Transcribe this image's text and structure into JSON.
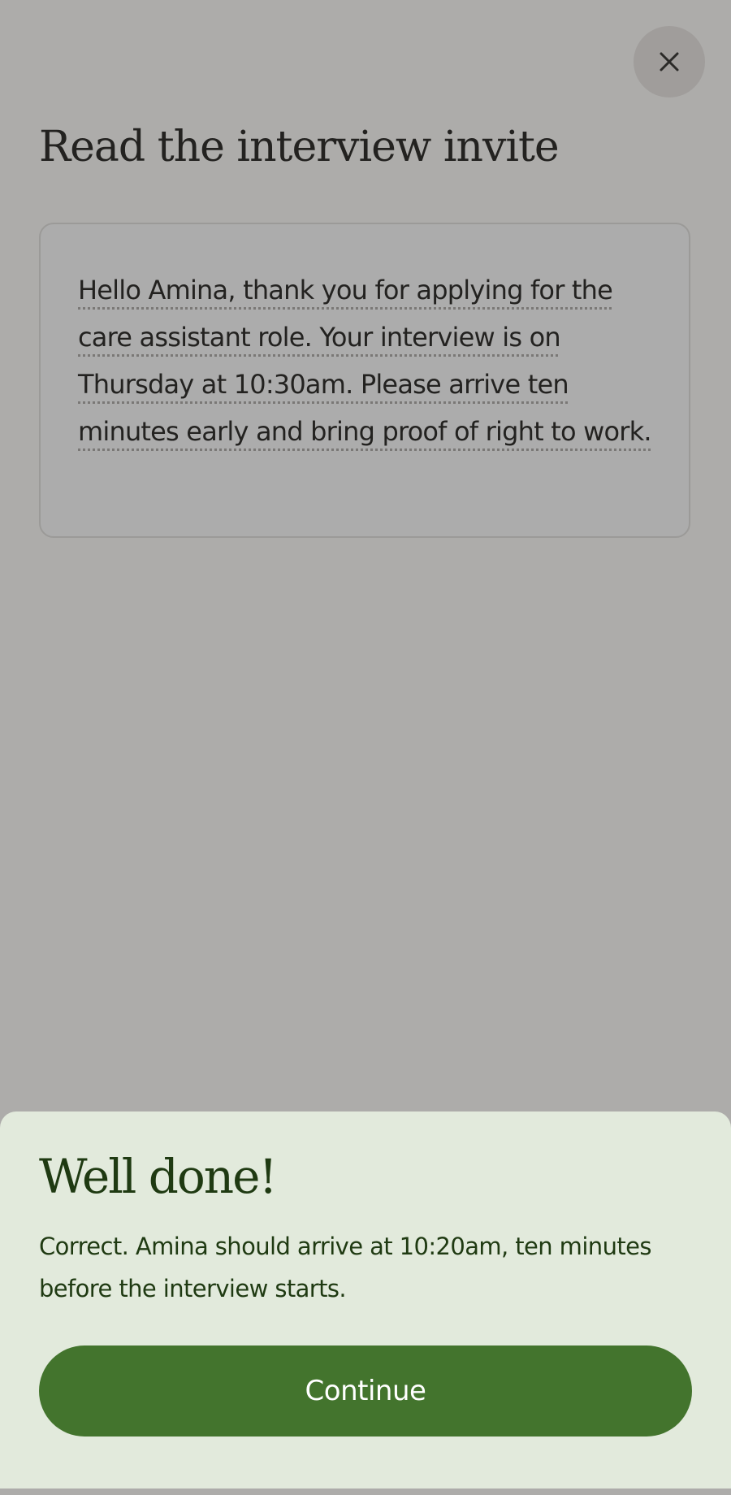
{
  "header": {
    "close_icon": "close-icon",
    "title": "Read the interview invite"
  },
  "message": {
    "text": "Hello Amina, thank you for applying for the care assistant role. Your interview is on Thursday at 10:30am. Please arrive ten minutes early and bring proof of right to work."
  },
  "feedback": {
    "title": "Well done!",
    "text": "Correct. Amina should arrive at 10:20am, ten minutes before the interview starts.",
    "continue_label": "Continue"
  },
  "colors": {
    "overlay": "#adacaa",
    "sheet_background": "#e2eadc",
    "accent_green": "#43742d",
    "feedback_text": "#1f3a12"
  }
}
